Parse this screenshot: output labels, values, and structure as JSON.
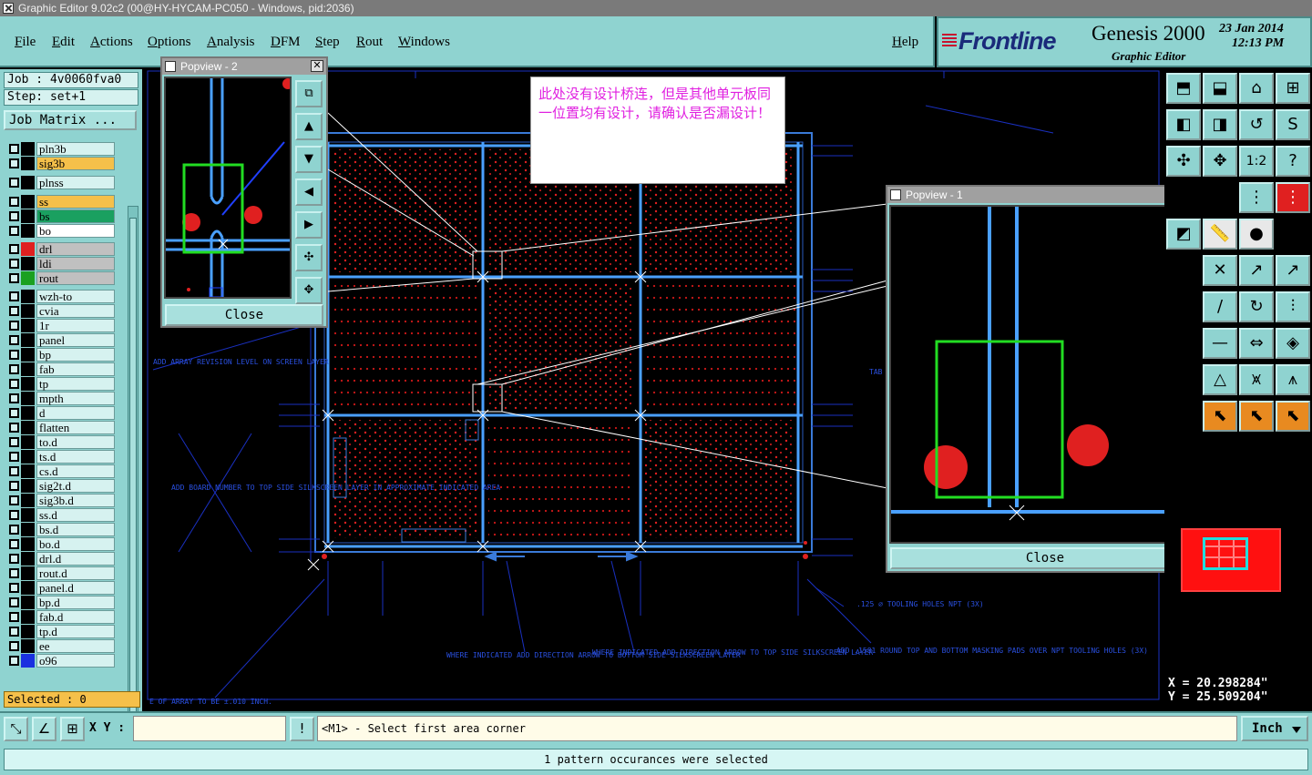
{
  "window": {
    "title": "Graphic Editor 9.02c2 (00@HY-HYCAM-PC050 - Windows, pid:2036)"
  },
  "menu": {
    "file": "File",
    "edit": "Edit",
    "actions": "Actions",
    "options": "Options",
    "analysis": "Analysis",
    "dfm": "DFM",
    "step": "Step",
    "rout": "Rout",
    "windows": "Windows",
    "help": "Help"
  },
  "brand": {
    "logo": "Frontline",
    "product": "Genesis 2000",
    "subtitle": "Graphic Editor",
    "date": "23 Jan 2014",
    "time": "12:13 PM"
  },
  "job": {
    "job": "Job : 4v0060fva0",
    "step": "Step: set+1",
    "matrix_button": "Job Matrix ..."
  },
  "layers": [
    {
      "name": "pln3b",
      "color": "#d6f2f0",
      "swatch": "#000000"
    },
    {
      "name": "sig3b",
      "color": "#f5c04a",
      "swatch": "#000000"
    },
    {
      "name": "plnss",
      "color": "#d6f2f0",
      "swatch": "#000000"
    },
    {
      "name": "ss",
      "color": "#f5c04a",
      "swatch": "#000000"
    },
    {
      "name": "bs",
      "color": "#1aa060",
      "swatch": "#000000"
    },
    {
      "name": "bo",
      "color": "#ffffff",
      "swatch": "#000000"
    },
    {
      "name": "drl",
      "color": "#c0c0c0",
      "swatch": "#e02020"
    },
    {
      "name": "ldi",
      "color": "#c0c0c0",
      "swatch": "#000000"
    },
    {
      "name": "rout",
      "color": "#c0c0c0",
      "swatch": "#1aa020"
    },
    {
      "name": "wzh-to",
      "color": "#d6f2f0",
      "swatch": "#000000"
    },
    {
      "name": "cvia",
      "color": "#d6f2f0",
      "swatch": "#000000"
    },
    {
      "name": "1r",
      "color": "#d6f2f0",
      "swatch": "#000000"
    },
    {
      "name": "panel",
      "color": "#d6f2f0",
      "swatch": "#000000"
    },
    {
      "name": "bp",
      "color": "#d6f2f0",
      "swatch": "#000000"
    },
    {
      "name": "fab",
      "color": "#d6f2f0",
      "swatch": "#000000"
    },
    {
      "name": "tp",
      "color": "#d6f2f0",
      "swatch": "#000000"
    },
    {
      "name": "mpth",
      "color": "#d6f2f0",
      "swatch": "#000000"
    },
    {
      "name": "d",
      "color": "#d6f2f0",
      "swatch": "#000000"
    },
    {
      "name": "flatten",
      "color": "#d6f2f0",
      "swatch": "#000000"
    },
    {
      "name": "to.d",
      "color": "#d6f2f0",
      "swatch": "#000000"
    },
    {
      "name": "ts.d",
      "color": "#d6f2f0",
      "swatch": "#000000"
    },
    {
      "name": "cs.d",
      "color": "#d6f2f0",
      "swatch": "#000000"
    },
    {
      "name": "sig2t.d",
      "color": "#d6f2f0",
      "swatch": "#000000"
    },
    {
      "name": "sig3b.d",
      "color": "#d6f2f0",
      "swatch": "#000000"
    },
    {
      "name": "ss.d",
      "color": "#d6f2f0",
      "swatch": "#000000"
    },
    {
      "name": "bs.d",
      "color": "#d6f2f0",
      "swatch": "#000000"
    },
    {
      "name": "bo.d",
      "color": "#d6f2f0",
      "swatch": "#000000"
    },
    {
      "name": "drl.d",
      "color": "#d6f2f0",
      "swatch": "#000000"
    },
    {
      "name": "rout.d",
      "color": "#d6f2f0",
      "swatch": "#000000"
    },
    {
      "name": "panel.d",
      "color": "#d6f2f0",
      "swatch": "#000000"
    },
    {
      "name": "bp.d",
      "color": "#d6f2f0",
      "swatch": "#000000"
    },
    {
      "name": "fab.d",
      "color": "#d6f2f0",
      "swatch": "#000000"
    },
    {
      "name": "tp.d",
      "color": "#d6f2f0",
      "swatch": "#000000"
    },
    {
      "name": "ee",
      "color": "#d6f2f0",
      "swatch": "#000000"
    },
    {
      "name": "o96",
      "color": "#d6f2f0",
      "swatch": "#1a30e0"
    }
  ],
  "selected": "Selected : 0",
  "note": "此处没有设计桥连，但是其他单元板同一位置均有设计，请确认是否漏设计！",
  "popview2": {
    "title": "Popview - 2",
    "close": "Close"
  },
  "popview1": {
    "title": "Popview - 1",
    "close": "Close"
  },
  "canvas_text": {
    "t1": "ADD ARRAY REVISION LEVEL ON SCREEN LAYER",
    "t2": "ADD BOARD NUMBER TO TOP SIDE SILKSCREEN LAYER IN APPROXIMATE INDICATED AREA",
    "t3": "WHERE INDICATED ADD DIRECTION ARROW TO BOTTOM SIDE SILKSCREEN LAYER",
    "t4": "WHERE INDICATED ADD DIRECTION ARROW TO TOP SIDE SILKSCREEN LAYER",
    "t5": "ADD .1581 ROUND TOP AND BOTTOM MASKING PADS OVER NPT TOOLING HOLES (3X)",
    "t6": ".125 ⌀ TOOLING HOLES NPT (3X)",
    "t7": "E OF ARRAY TO BE ±.010 INCH.",
    "t8": "TAB"
  },
  "coords": {
    "x": "X = 20.298284\"",
    "y": "Y = 25.509204\""
  },
  "cmd": {
    "xy_label": "X Y :",
    "xy_value": "",
    "prompt": "<M1> - Select first area corner",
    "units": "Inch"
  },
  "status": "1 pattern occurances were selected"
}
